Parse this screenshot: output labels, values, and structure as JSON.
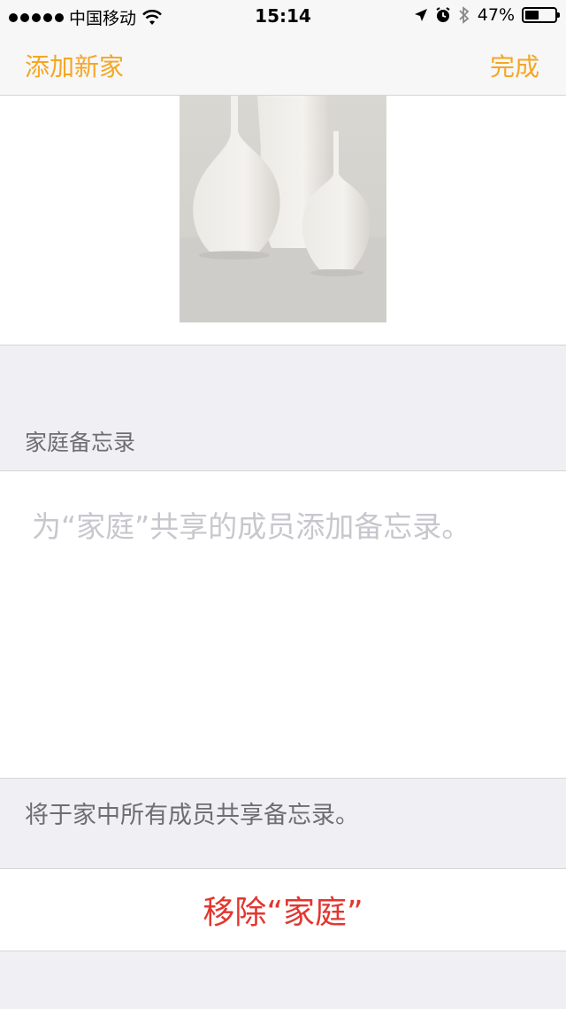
{
  "status_bar": {
    "carrier": "中国移动",
    "time": "15:14",
    "battery_percent": "47%",
    "battery_level": 0.47
  },
  "nav": {
    "left_label": "添加新家",
    "right_label": "完成",
    "accent_color": "#f5a623"
  },
  "notes": {
    "section_title": "家庭备忘录",
    "placeholder": "为“家庭”共享的成员添加备忘录。",
    "footer": "将于家中所有成员共享备忘录。"
  },
  "actions": {
    "remove_label": "移除“家庭”",
    "remove_color": "#e2362f"
  },
  "icons": [
    "wifi-icon",
    "location-icon",
    "alarm-icon",
    "bluetooth-icon",
    "battery-icon"
  ]
}
